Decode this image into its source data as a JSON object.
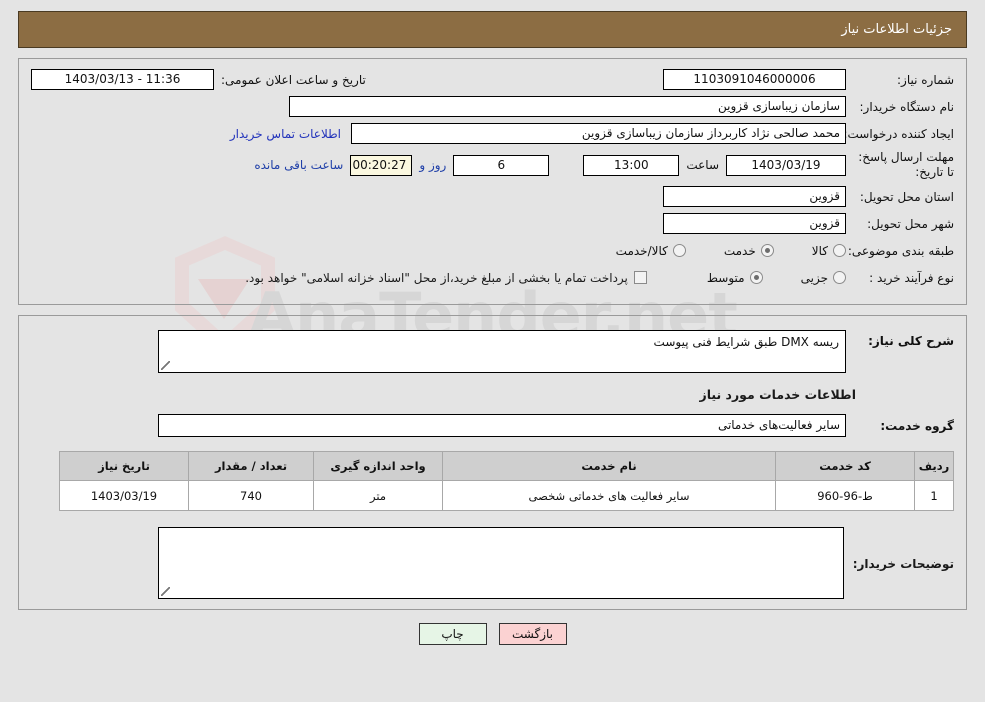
{
  "header": {
    "title": "جزئیات اطلاعات نیاز"
  },
  "watermark": {
    "text": "AnaTender.net",
    "shield": "shield-logo"
  },
  "info": {
    "need_number_label": "شماره نیاز:",
    "need_number_value": "1103091046000006",
    "announce_label": "تاریخ و ساعت اعلان عمومی:",
    "announce_value": "11:36 - 1403/03/13",
    "buyer_org_label": "نام دستگاه خریدار:",
    "buyer_org_value": "سازمان زیباسازی قزوین",
    "requester_label": "ایجاد کننده درخواست:",
    "requester_value": "محمد صالحی نژاد کاربرداز سازمان زیباسازی قزوین",
    "contact_link": "اطلاعات تماس خریدار",
    "deadline_label": "مهلت ارسال پاسخ: تا تاریخ:",
    "deadline_date": "1403/03/19",
    "hour_label": "ساعت",
    "deadline_time": "13:00",
    "days_value": "6",
    "days_label": "روز و",
    "countdown_value": "00:20:27",
    "remaining_label": "ساعت باقی مانده",
    "province_label": "استان محل تحویل:",
    "province_value": "قزوین",
    "city_label": "شهر محل تحویل:",
    "city_value": "قزوین",
    "category_label": "طبقه بندی موضوعی:",
    "category_options": [
      {
        "label": "کالا",
        "selected": false
      },
      {
        "label": "خدمت",
        "selected": true
      },
      {
        "label": "کالا/خدمت",
        "selected": false
      }
    ],
    "process_label": "نوع فرآیند خرید :",
    "process_options": [
      {
        "label": "جزیی",
        "selected": false
      },
      {
        "label": "متوسط",
        "selected": true
      }
    ],
    "treasury_checkbox_label": "پرداخت تمام یا بخشی از مبلغ خرید،از محل \"اسناد خزانه اسلامی\" خواهد بود.",
    "treasury_checked": false
  },
  "details": {
    "general_desc_label": "شرح کلی نیاز:",
    "general_desc_value": "ریسه DMX طبق شرایط فنی پیوست",
    "services_section_title": "اطلاعات خدمات مورد نیاز",
    "service_group_label": "گروه خدمت:",
    "service_group_value": "سایر فعالیت‌های خدماتی",
    "buyer_notes_label": "توضیحات خریدار:",
    "buyer_notes_value": ""
  },
  "table": {
    "columns": [
      "ردیف",
      "کد خدمت",
      "نام خدمت",
      "واحد اندازه گیری",
      "تعداد / مقدار",
      "تاریخ نیاز"
    ],
    "rows": [
      {
        "radif": "1",
        "code": "ط-96-960",
        "name": "سایر فعالیت های خدماتی شخصی",
        "unit": "متر",
        "qty": "740",
        "date": "1403/03/19"
      }
    ]
  },
  "footer": {
    "print_label": "چاپ",
    "back_label": "بازگشت"
  },
  "colors": {
    "header_bg": "#8c6d43",
    "page_bg": "#e4e4e4",
    "link": "#2233bb",
    "countdown_bg": "#fbf8e0",
    "print_bg": "#e6f5e6",
    "back_bg": "#fbd2d2"
  }
}
